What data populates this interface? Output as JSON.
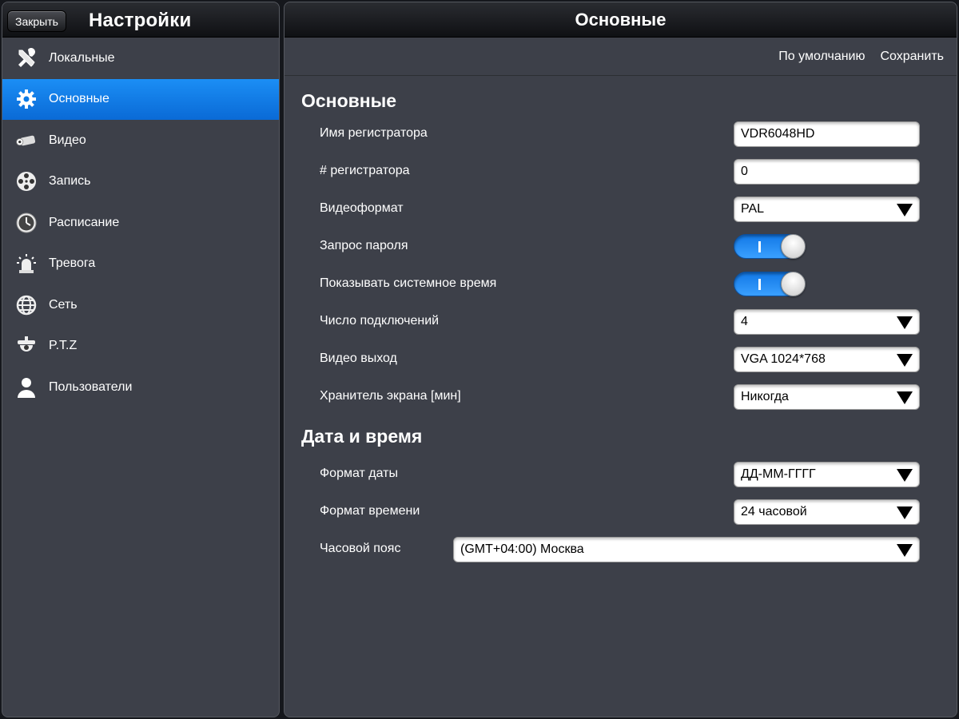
{
  "left": {
    "close_label": "Закрыть",
    "title": "Настройки",
    "items": [
      {
        "label": "Локальные",
        "icon": "tools-icon"
      },
      {
        "label": "Основные",
        "icon": "gear-icon",
        "active": true
      },
      {
        "label": "Видео",
        "icon": "camera-icon"
      },
      {
        "label": "Запись",
        "icon": "film-reel-icon"
      },
      {
        "label": "Расписание",
        "icon": "clock-icon"
      },
      {
        "label": "Тревога",
        "icon": "alarm-siren-icon"
      },
      {
        "label": "Сеть",
        "icon": "network-globe-icon"
      },
      {
        "label": "P.T.Z",
        "icon": "ptz-dome-camera-icon"
      },
      {
        "label": "Пользователи",
        "icon": "user-icon"
      }
    ]
  },
  "right": {
    "title": "Основные",
    "toolbar": {
      "default_label": "По умолчанию",
      "save_label": "Сохранить"
    },
    "section_general": {
      "title": "Основные",
      "device_name": {
        "label": "Имя регистратора",
        "value": "VDR6048HD"
      },
      "device_number": {
        "label": "# регистратора",
        "value": "0"
      },
      "video_format": {
        "label": "Видеоформат",
        "value": "PAL"
      },
      "password_request": {
        "label": "Запрос пароля",
        "value": "I"
      },
      "show_system_time": {
        "label": "Показывать системное время",
        "value": "I"
      },
      "connections": {
        "label": "Число подключений",
        "value": "4"
      },
      "video_output": {
        "label": "Видео выход",
        "value": "VGA 1024*768"
      },
      "screensaver": {
        "label": "Хранитель экрана [мин]",
        "value": "Никогда"
      }
    },
    "section_datetime": {
      "title": "Дата и время",
      "date_format": {
        "label": "Формат даты",
        "value": "ДД-ММ-ГГГГ"
      },
      "time_format": {
        "label": "Формат времени",
        "value": "24 часовой"
      },
      "timezone": {
        "label": "Часовой пояс",
        "value": "(GMT+04:00) Москва"
      }
    }
  },
  "colors": {
    "accent": "#0a7ae6",
    "panel_bg": "#3d4049",
    "toggle_on": "#1a86f0"
  }
}
